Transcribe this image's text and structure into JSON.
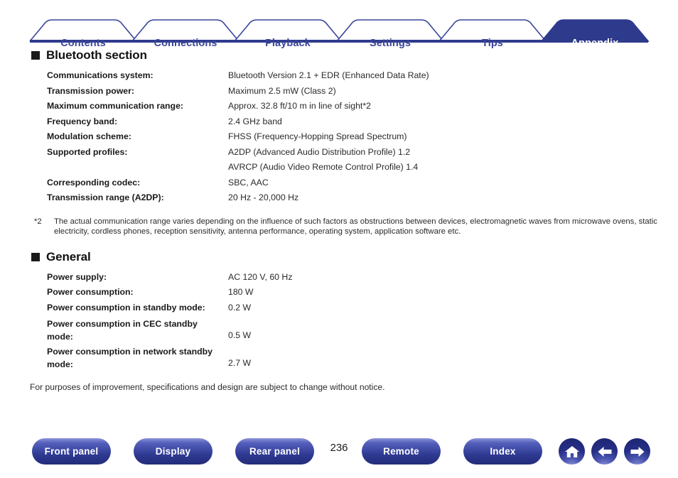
{
  "tabs": [
    {
      "label": "Contents",
      "active": false
    },
    {
      "label": "Connections",
      "active": false
    },
    {
      "label": "Playback",
      "active": false
    },
    {
      "label": "Settings",
      "active": false
    },
    {
      "label": "Tips",
      "active": false
    },
    {
      "label": "Appendix",
      "active": true
    }
  ],
  "colors": {
    "tab_outline": "#3b4699",
    "tab_active_fill": "#2e3a8c",
    "tab_text": "#3b4699",
    "tab_active_text": "#ffffff",
    "rule": "#2e3a8c",
    "button_blue": "#2e3a92",
    "text": "#1a1a1a"
  },
  "sections": [
    {
      "title": "Bluetooth section",
      "bullet": "filled-square",
      "rows": [
        {
          "label": "Communications system:",
          "value": "Bluetooth Version 2.1 + EDR (Enhanced Data Rate)"
        },
        {
          "label": "Transmission power:",
          "value": "Maximum 2.5 mW (Class 2)"
        },
        {
          "label": "Maximum communication range:",
          "value": "Approx. 32.8 ft/10 m in line of sight*2"
        },
        {
          "label": "Frequency band:",
          "value": "2.4 GHz band"
        },
        {
          "label": "Modulation scheme:",
          "value": "FHSS (Frequency-Hopping Spread Spectrum)"
        },
        {
          "label": "Supported profiles:",
          "value": "A2DP (Advanced Audio Distribution Profile) 1.2"
        },
        {
          "label": "",
          "value": "AVRCP (Audio Video Remote Control Profile) 1.4"
        },
        {
          "label": "Corresponding codec:",
          "value": "SBC, AAC"
        },
        {
          "label": "Transmission range (A2DP):",
          "value": "20 Hz - 20,000 Hz"
        }
      ]
    }
  ],
  "footnote": {
    "mark": "*2",
    "text": "The actual communication range varies depending on the influence of such factors as obstructions between devices, electromagnetic waves from microwave ovens, static electricity, cordless phones, reception sensitivity, antenna performance, operating system, application software etc."
  },
  "general": {
    "title": "General",
    "bullet": "filled-square",
    "rows": [
      {
        "label": "Power supply:",
        "value": "AC 120 V, 60 Hz",
        "multiline": false
      },
      {
        "label": "Power consumption:",
        "value": "180 W",
        "multiline": false
      },
      {
        "label": "Power consumption in standby mode:",
        "value": "0.2 W",
        "multiline": false
      },
      {
        "label": "Power consumption in CEC standby mode:",
        "value": "0.5 W",
        "multiline": true
      },
      {
        "label": "Power consumption in network standby mode:",
        "value": "2.7 W",
        "multiline": true
      }
    ]
  },
  "closing_note": "For purposes of improvement, specifications and design are subject to change without notice.",
  "footer": {
    "page_number": "236",
    "buttons": [
      {
        "label": "Front panel"
      },
      {
        "label": "Display"
      },
      {
        "label": "Rear panel"
      },
      {
        "label": "Remote"
      },
      {
        "label": "Index"
      }
    ],
    "icons": [
      {
        "name": "home-icon"
      },
      {
        "name": "arrow-left-icon"
      },
      {
        "name": "arrow-right-icon"
      }
    ]
  }
}
